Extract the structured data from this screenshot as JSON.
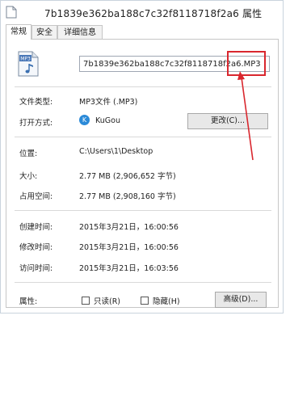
{
  "window": {
    "title": "7b1839e362ba188c7c32f8118718f2a6 属性"
  },
  "tabs": [
    {
      "label": "常规",
      "active": true
    },
    {
      "label": "安全",
      "active": false
    },
    {
      "label": "详细信息",
      "active": false
    }
  ],
  "general": {
    "file_icon_text": "MP3",
    "filename": "7b1839e362ba188c7c32f8118718f2a6.MP3",
    "file_type_label": "文件类型:",
    "file_type_value": "MP3文件 (.MP3)",
    "open_with_label": "打开方式:",
    "open_with_app_icon": "K",
    "open_with_value": "KuGou",
    "change_button": "更改(C)...",
    "location_label": "位置:",
    "location_value": "C:\\Users\\1\\Desktop",
    "size_label": "大小:",
    "size_value": "2.77 MB (2,906,652 字节)",
    "size_on_disk_label": "占用空间:",
    "size_on_disk_value": "2.77 MB (2,908,160 字节)",
    "created_label": "创建时间:",
    "created_value": "2015年3月21日，16:00:56",
    "modified_label": "修改时间:",
    "modified_value": "2015年3月21日，16:00:56",
    "accessed_label": "访问时间:",
    "accessed_value": "2015年3月21日，16:03:56",
    "attributes_label": "属性:",
    "readonly_label": "只读(R)",
    "hidden_label": "隐藏(H)",
    "advanced_button": "高级(D)..."
  },
  "annotation_color": "#d9272e"
}
